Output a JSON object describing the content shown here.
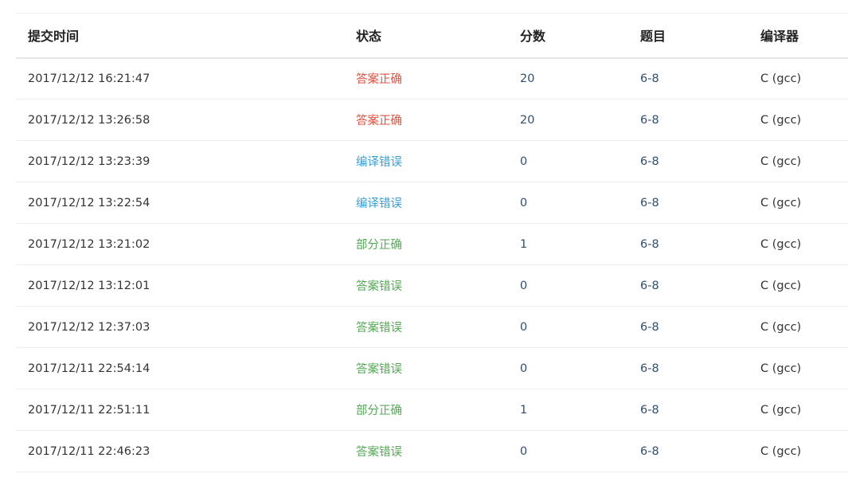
{
  "headers": {
    "time": "提交时间",
    "status": "状态",
    "score": "分数",
    "problem": "题目",
    "compiler": "编译器"
  },
  "status_colors": {
    "答案正确": "#e0523f",
    "编译错误": "#3a9fd6",
    "部分正确": "#55aa55",
    "答案错误": "#55aa55"
  },
  "rows": [
    {
      "time": "2017/12/12 16:21:47",
      "status": "答案正确",
      "score": "20",
      "problem": "6-8",
      "compiler": "C (gcc)"
    },
    {
      "time": "2017/12/12 13:26:58",
      "status": "答案正确",
      "score": "20",
      "problem": "6-8",
      "compiler": "C (gcc)"
    },
    {
      "time": "2017/12/12 13:23:39",
      "status": "编译错误",
      "score": "0",
      "problem": "6-8",
      "compiler": "C (gcc)"
    },
    {
      "time": "2017/12/12 13:22:54",
      "status": "编译错误",
      "score": "0",
      "problem": "6-8",
      "compiler": "C (gcc)"
    },
    {
      "time": "2017/12/12 13:21:02",
      "status": "部分正确",
      "score": "1",
      "problem": "6-8",
      "compiler": "C (gcc)"
    },
    {
      "time": "2017/12/12 13:12:01",
      "status": "答案错误",
      "score": "0",
      "problem": "6-8",
      "compiler": "C (gcc)"
    },
    {
      "time": "2017/12/12 12:37:03",
      "status": "答案错误",
      "score": "0",
      "problem": "6-8",
      "compiler": "C (gcc)"
    },
    {
      "time": "2017/12/11 22:54:14",
      "status": "答案错误",
      "score": "0",
      "problem": "6-8",
      "compiler": "C (gcc)"
    },
    {
      "time": "2017/12/11 22:51:11",
      "status": "部分正确",
      "score": "1",
      "problem": "6-8",
      "compiler": "C (gcc)"
    },
    {
      "time": "2017/12/11 22:46:23",
      "status": "答案错误",
      "score": "0",
      "problem": "6-8",
      "compiler": "C (gcc)"
    }
  ]
}
